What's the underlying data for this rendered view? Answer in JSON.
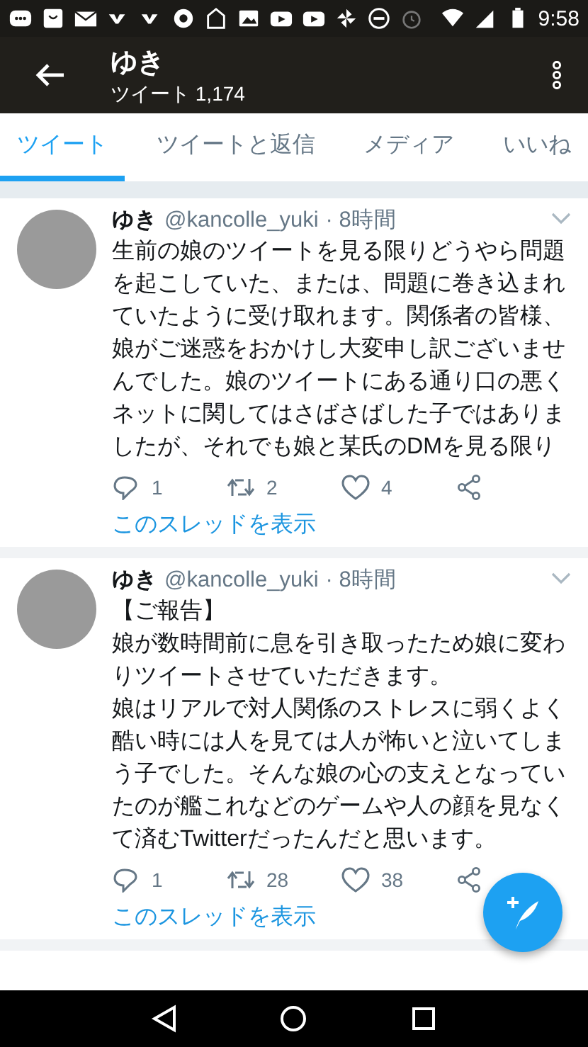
{
  "status_bar": {
    "time": "9:58"
  },
  "header": {
    "title": "ゆき",
    "subtitle": "ツイート 1,174"
  },
  "tabs": [
    {
      "label": "ツイート",
      "selected": true
    },
    {
      "label": "ツイートと返信",
      "selected": false
    },
    {
      "label": "メディア",
      "selected": false
    },
    {
      "label": "いいね",
      "selected": false
    }
  ],
  "tweets": [
    {
      "name": "ゆき",
      "handle": "@kancolle_yuki",
      "time": "· 8時間",
      "text": [
        "生前の娘のツイートを見る限りどうやら問題を起こしていた、または、問題に巻き込まれていたように受け取れます。関係者の皆様、娘がご迷惑をおかけし大変申し訳ございませんでした。娘のツイートにある通り口の悪くネットに関してはさばさばした子ではありましたが、それでも娘と某氏のDMを見る限り"
      ],
      "replies": "1",
      "retweets": "2",
      "likes": "4",
      "thread_link": "このスレッドを表示"
    },
    {
      "name": "ゆき",
      "handle": "@kancolle_yuki",
      "time": "· 8時間",
      "text": [
        "【ご報告】",
        "娘が数時間前に息を引き取ったため娘に変わりツイートさせていただきます。",
        "娘はリアルで対人関係のストレスに弱くよく酷い時には人を見ては人が怖いと泣いてしまう子でした。そんな娘の心の支えとなっていたのが艦これなどのゲームや人の顔を見なくて済むTwitterだったんだと思います。"
      ],
      "replies": "1",
      "retweets": "28",
      "likes": "38",
      "thread_link": "このスレッドを表示"
    }
  ]
}
